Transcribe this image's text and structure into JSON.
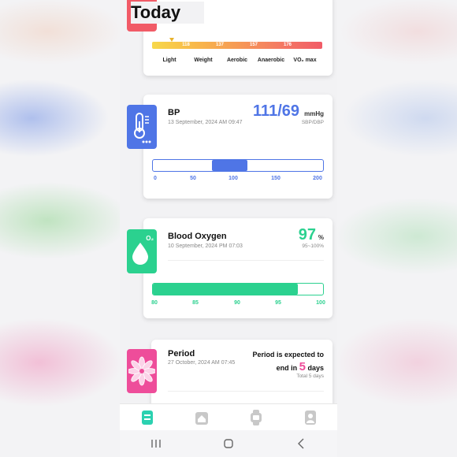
{
  "header": {
    "title": "Today"
  },
  "colors": {
    "bp_blue": "#4f75e6",
    "oxygen_green": "#2bd18f",
    "period_pink": "#ee4d9a",
    "heart_red": "#f15b67"
  },
  "heart_rate_zones": {
    "tick_values": [
      "118",
      "137",
      "157",
      "176"
    ],
    "zone_labels": [
      "Light",
      "Weight",
      "Aerobic",
      "Anaerobic",
      "VO₂ max"
    ]
  },
  "bp": {
    "icon": "thermometer-icon",
    "title": "BP",
    "timestamp": "13 September, 2024 AM 09:47",
    "value": "111/69",
    "unit": "mmHg",
    "sublabel": "SBP/DBP",
    "scale": [
      "0",
      "50",
      "100",
      "150",
      "200"
    ],
    "range_low": 69,
    "range_high": 111,
    "scale_min": 0,
    "scale_max": 200
  },
  "oxygen": {
    "icon": "water-drop-icon",
    "icon_badge": "O₂",
    "title": "Blood Oxygen",
    "timestamp": "10 September, 2024 PM 07:03",
    "value": "97",
    "unit": "%",
    "range": "95~100%",
    "scale": [
      "80",
      "85",
      "90",
      "95",
      "100"
    ],
    "level": 97,
    "scale_min": 80,
    "scale_max": 100
  },
  "period": {
    "icon": "flower-icon",
    "title": "Period",
    "timestamp": "27 October, 2024 AM 07:45",
    "message_line1": "Period is expected to",
    "message_prefix": "end in",
    "days_value": "5",
    "days_unit": "days",
    "total": "Total 5 days"
  },
  "bottom_nav": [
    "today-icon",
    "home-icon",
    "watch-icon",
    "profile-icon"
  ],
  "system_nav": [
    "recent-apps-icon",
    "home-button-icon",
    "back-icon"
  ]
}
